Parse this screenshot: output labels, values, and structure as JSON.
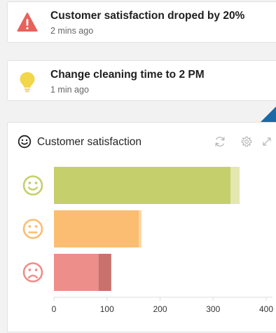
{
  "alerts": [
    {
      "icon": "warning-triangle-icon",
      "title": "Customer satisfaction droped by 20%",
      "time": "2 mins ago",
      "color": "#e8615a"
    },
    {
      "icon": "lightbulb-icon",
      "title": "Change cleaning time to 2 PM",
      "time": "1 min ago",
      "color": "#f2d64b"
    }
  ],
  "panel": {
    "title": "Customer satisfaction",
    "title_icon": "smiley-outline-icon",
    "tools": [
      "refresh-icon",
      "gear-icon",
      "expand-icon"
    ]
  },
  "chart_data": {
    "type": "bar",
    "orientation": "horizontal",
    "categories": [
      "happy",
      "neutral",
      "sad"
    ],
    "category_icons": [
      "happy-face-icon",
      "neutral-face-icon",
      "sad-face-icon"
    ],
    "category_colors": [
      "#c5cf6b",
      "#fbbd72",
      "#ee8e8a"
    ],
    "series": [
      {
        "values": [
          333,
          160,
          84
        ]
      },
      {
        "values": [
          17,
          5,
          24
        ]
      }
    ],
    "series_colors": [
      [
        "#c5cf6b",
        "#fbbd72",
        "#ee8e8a"
      ],
      [
        "#e4e7b0",
        "#fcd6a6",
        "#c9716d"
      ]
    ],
    "xlim": [
      0,
      400
    ],
    "xticks": [
      "0",
      "100",
      "200",
      "300",
      "400"
    ],
    "grid": false
  }
}
